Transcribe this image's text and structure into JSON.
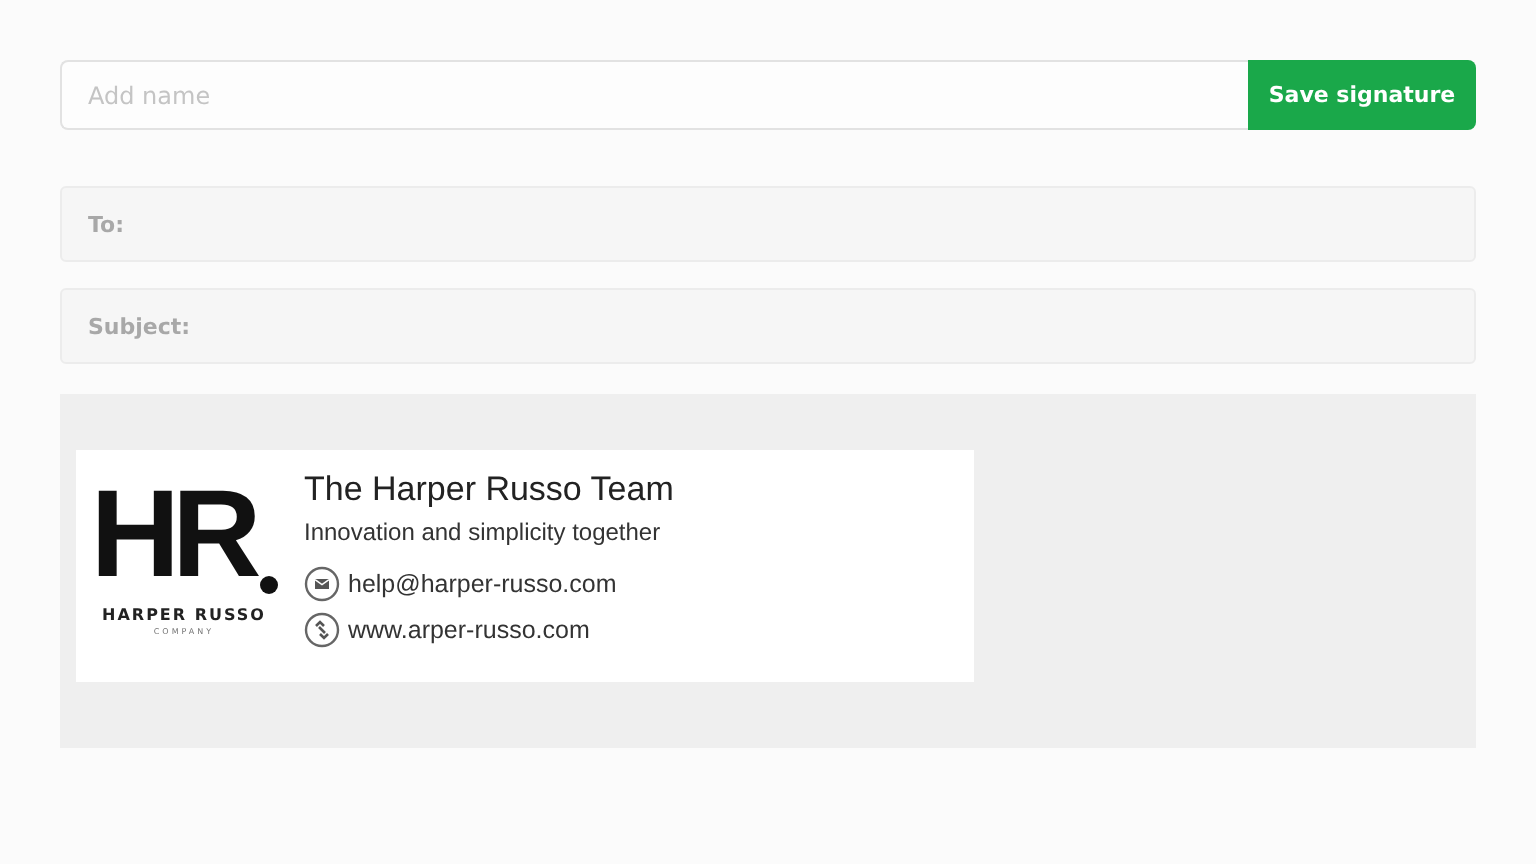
{
  "name_field": {
    "placeholder": "Add name"
  },
  "save_button": {
    "label": "Save signature"
  },
  "recipient_fields": [
    {
      "label": "To:"
    },
    {
      "label": "Subject:"
    }
  ],
  "signature": {
    "logo": {
      "mark": "HR",
      "name": "HARPER RUSSO",
      "tagline": "COMPANY"
    },
    "title": "The Harper Russo Team",
    "subtitle": "Innovation and simplicity together",
    "contacts": [
      {
        "kind": "email",
        "text": "help@harper-russo.com"
      },
      {
        "kind": "link",
        "text": "www.arper-russo.com"
      }
    ]
  }
}
